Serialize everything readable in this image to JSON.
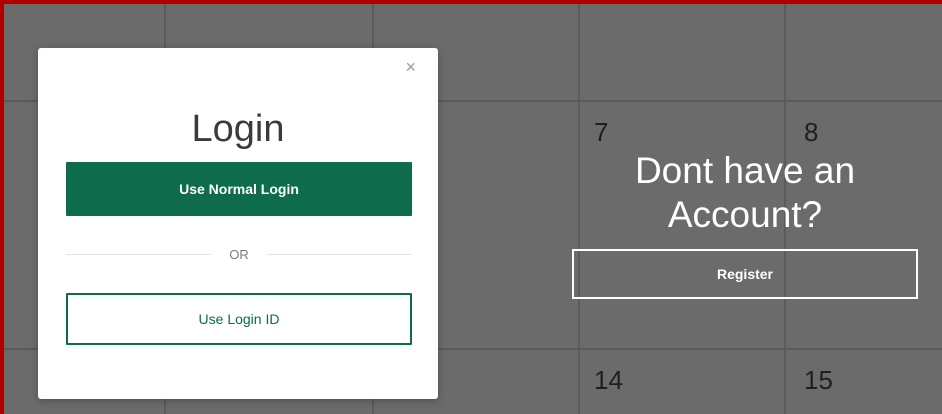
{
  "calendar": {
    "days": [
      {
        "label": "7"
      },
      {
        "label": "8"
      },
      {
        "label": "14"
      },
      {
        "label": "15"
      }
    ]
  },
  "promo": {
    "title": "Dont have an Account?",
    "register_label": "Register"
  },
  "modal": {
    "close_symbol": "×",
    "title": "Login",
    "normal_login_label": "Use Normal Login",
    "or_text": "OR",
    "login_id_label": "Use Login ID"
  },
  "colors": {
    "brand_green": "#0e6b4b",
    "overlay_gray": "#6b6b6b",
    "frame_red": "#b10000"
  }
}
